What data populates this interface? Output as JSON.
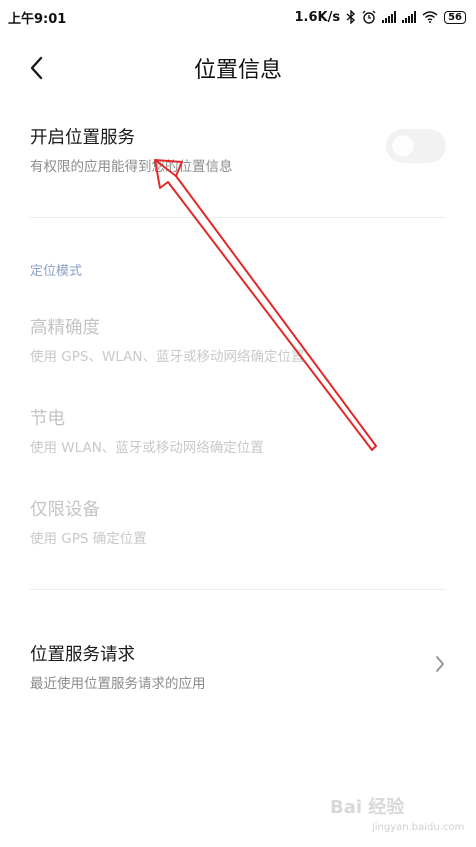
{
  "status_bar": {
    "time": "上午9:01",
    "speed": "1.6K/s",
    "battery": "56",
    "icons": [
      "bluetooth-icon",
      "alarm-icon",
      "signal-icon",
      "signal-icon",
      "wifi-icon",
      "battery-icon"
    ]
  },
  "header": {
    "title": "位置信息",
    "back_icon": "back-arrow-icon"
  },
  "location_service": {
    "title": "开启位置服务",
    "subtitle": "有权限的应用能得到您的位置信息",
    "enabled": false
  },
  "section_label": "定位模式",
  "modes": [
    {
      "title": "高精确度",
      "subtitle": "使用 GPS、WLAN、蓝牙或移动网络确定位置"
    },
    {
      "title": "节电",
      "subtitle": "使用 WLAN、蓝牙或移动网络确定位置"
    },
    {
      "title": "仅限设备",
      "subtitle": "使用 GPS 确定位置"
    }
  ],
  "requests": {
    "title": "位置服务请求",
    "subtitle": "最近使用位置服务请求的应用",
    "icon": "chevron-right-icon"
  },
  "annotation": {
    "color": "#e02a2a"
  },
  "watermark": {
    "text": "Bai 经验",
    "sub": "jingyan.baidu.com"
  }
}
